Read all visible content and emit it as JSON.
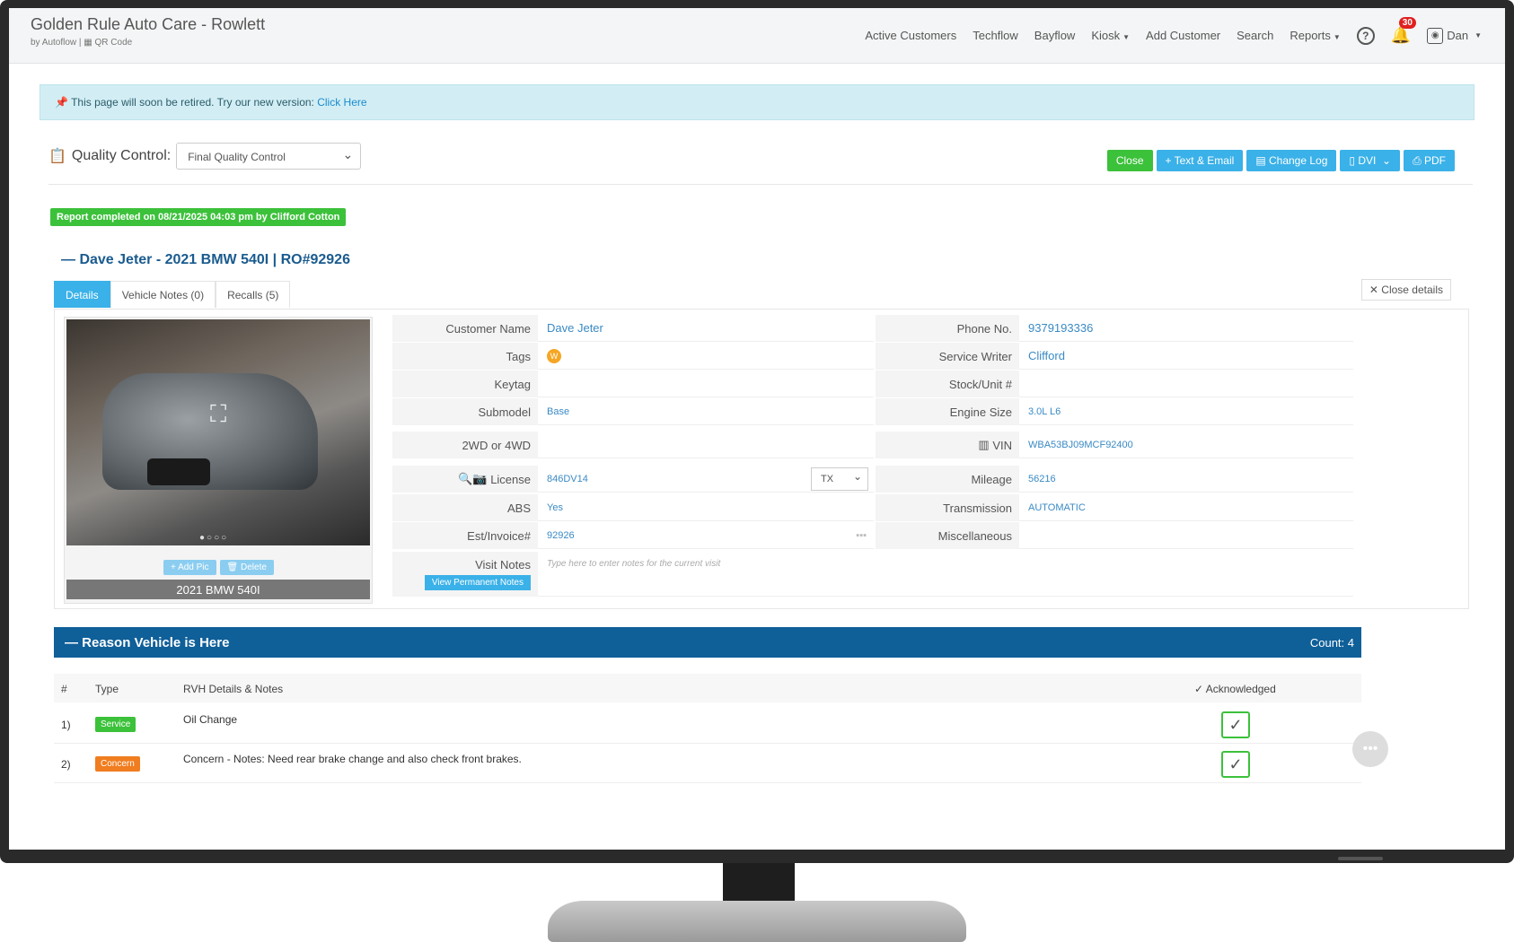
{
  "brand": {
    "title": "Golden Rule Auto Care - Rowlett",
    "sub": "by Autoflow | ▦ QR Code"
  },
  "nav": {
    "items": [
      "Active Customers",
      "Techflow",
      "Bayflow",
      "Kiosk",
      "Add Customer",
      "Search",
      "Reports"
    ],
    "notification_count": "30",
    "user": "Dan"
  },
  "alert": {
    "text": "This page will soon be retired. Try our new version: ",
    "link": "Click Here"
  },
  "qc": {
    "label": "Quality Control:",
    "selected": "Final Quality Control"
  },
  "actions": {
    "close": "Close",
    "text_email": "+ Text & Email",
    "change_log": "Change Log",
    "dvi": "DVI",
    "pdf": "PDF"
  },
  "report": "Report completed on 08/21/2025 04:03 pm by Clifford Cotton",
  "vehicle_title": "— Dave Jeter - 2021 BMW 540I | RO#92926",
  "tabs": [
    "Details",
    "Vehicle Notes (0)",
    "Recalls (5)"
  ],
  "close_details": "✕ Close details",
  "photo": {
    "add": "+ Add Pic",
    "delete": "🗑 Delete",
    "caption": "2021 BMW 540I"
  },
  "fields": {
    "customer_name": {
      "label": "Customer Name",
      "value": "Dave Jeter"
    },
    "tags": {
      "label": "Tags"
    },
    "keytag": {
      "label": "Keytag",
      "value": ""
    },
    "submodel": {
      "label": "Submodel",
      "value": "Base"
    },
    "drive": {
      "label": "2WD or 4WD",
      "value": ""
    },
    "license": {
      "label": "License",
      "value": "846DV14",
      "state": "TX"
    },
    "abs": {
      "label": "ABS",
      "value": "Yes"
    },
    "est": {
      "label": "Est/Invoice#",
      "value": "92926"
    },
    "visit_notes": {
      "label": "Visit Notes",
      "placeholder": "Type here to enter notes for the current visit",
      "button": "View Permanent Notes"
    },
    "phone": {
      "label": "Phone No.",
      "value": "9379193336"
    },
    "writer": {
      "label": "Service Writer",
      "value": "Clifford"
    },
    "stock": {
      "label": "Stock/Unit #",
      "value": ""
    },
    "engine": {
      "label": "Engine Size",
      "value": "3.0L L6"
    },
    "vin": {
      "label": "VIN",
      "value": "WBA53BJ09MCF92400"
    },
    "mileage": {
      "label": "Mileage",
      "value": "56216"
    },
    "transmission": {
      "label": "Transmission",
      "value": "AUTOMATIC"
    },
    "misc": {
      "label": "Miscellaneous",
      "value": ""
    }
  },
  "reason": {
    "title": "— Reason Vehicle is Here",
    "count": "Count: 4",
    "headers": {
      "num": "#",
      "type": "Type",
      "details": "RVH Details & Notes",
      "ack": "✓ Acknowledged"
    },
    "rows": [
      {
        "num": "1)",
        "type": "Service",
        "details": "Oil Change"
      },
      {
        "num": "2)",
        "type": "Concern",
        "details": "Concern - Notes: Need rear brake change and also check front brakes."
      }
    ]
  }
}
